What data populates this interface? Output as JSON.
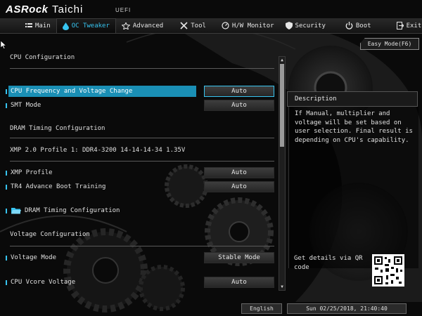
{
  "header": {
    "brand": "ASRock",
    "model": "Taichi",
    "firmware": "UEFI"
  },
  "nav": {
    "tabs": [
      {
        "label": "Main",
        "icon": "list-icon",
        "active": false
      },
      {
        "label": "OC Tweaker",
        "icon": "drop-icon",
        "active": true
      },
      {
        "label": "Advanced",
        "icon": "star-icon",
        "active": false
      },
      {
        "label": "Tool",
        "icon": "wrench-icon",
        "active": false
      },
      {
        "label": "H/W Monitor",
        "icon": "monitor-icon",
        "active": false
      },
      {
        "label": "Security",
        "icon": "shield-icon",
        "active": false
      },
      {
        "label": "Boot",
        "icon": "power-icon",
        "active": false
      },
      {
        "label": "Exit",
        "icon": "exit-icon",
        "active": false
      }
    ]
  },
  "easy_mode": "Easy Mode(F6)",
  "main": {
    "cpu_config_title": "CPU Configuration",
    "cpu_freq": {
      "label": "CPU Frequency and Voltage Change",
      "value": "Auto"
    },
    "smt_mode": {
      "label": "SMT Mode",
      "value": "Auto"
    },
    "dram_timing_title": "DRAM Timing Configuration",
    "xmp_info": "XMP 2.0 Profile 1: DDR4-3200 14-14-14-34 1.35V",
    "xmp_profile": {
      "label": "XMP Profile",
      "value": "Auto"
    },
    "tr4_training": {
      "label": "TR4 Advance Boot Training",
      "value": "Auto"
    },
    "dram_timing_folder": "DRAM Timing Configuration",
    "voltage_config_title": "Voltage Configuration",
    "voltage_mode": {
      "label": "Voltage Mode",
      "value": "Stable Mode"
    },
    "cpu_vcore": {
      "label": "CPU Vcore Voltage",
      "value": "Auto"
    }
  },
  "description": {
    "title": "Description",
    "text": "If Manual, multiplier and voltage will be set based on user selection. Final result is depending on CPU's capability.",
    "qr_text": "Get details via QR code"
  },
  "footer": {
    "language": "English",
    "datetime": "Sun 02/25/2018, 21:40:40"
  },
  "colors": {
    "accent": "#37c4f0",
    "selected_bar": "#1a8fb5",
    "background": "#0a0a0a"
  }
}
